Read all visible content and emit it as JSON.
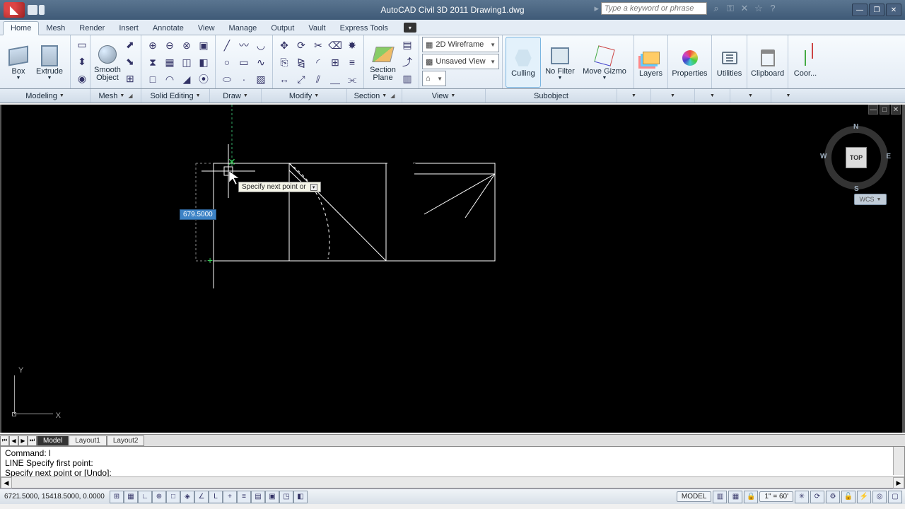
{
  "title": "AutoCAD Civil 3D 2011   Drawing1.dwg",
  "search_placeholder": "Type a keyword or phrase",
  "ribbon_tabs": [
    "Home",
    "Mesh",
    "Render",
    "Insert",
    "Annotate",
    "View",
    "Manage",
    "Output",
    "Vault",
    "Express Tools"
  ],
  "panels": {
    "modeling": {
      "label": "Modeling",
      "box": "Box",
      "extrude": "Extrude",
      "smooth": "Smooth\nObject"
    },
    "mesh": {
      "label": "Mesh"
    },
    "solid_editing": {
      "label": "Solid Editing"
    },
    "draw": {
      "label": "Draw"
    },
    "modify": {
      "label": "Modify"
    },
    "section": {
      "label": "Section",
      "plane": "Section\nPlane"
    },
    "view": {
      "label": "View",
      "visual_style": "2D Wireframe",
      "named_view": "Unsaved View"
    },
    "subobject": {
      "label": "Subobject",
      "culling": "Culling",
      "nofilter": "No Filter",
      "movegizmo": "Move Gizmo"
    },
    "layers_panel": "Layers",
    "properties_panel": "Properties",
    "utilities_panel": "Utilities",
    "clipboard_panel": "Clipboard",
    "coord_panel": "Coor..."
  },
  "viewcube": {
    "face": "TOP",
    "n": "N",
    "e": "E",
    "s": "S",
    "w": "W",
    "wcs": "WCS"
  },
  "ucs": {
    "x": "X",
    "y": "Y"
  },
  "dyn_input_value": "679.5000",
  "dyn_tooltip": "Specify next point or",
  "layout_tabs": {
    "model": "Model",
    "l1": "Layout1",
    "l2": "Layout2"
  },
  "command_lines": {
    "l1": "Command: l",
    "l2": "LINE Specify first point:",
    "l3": "Specify next point or [Undo]:"
  },
  "status": {
    "coords": "6721.5000, 15418.5000, 0.0000",
    "model": "MODEL",
    "scale": "1\" = 60'"
  }
}
